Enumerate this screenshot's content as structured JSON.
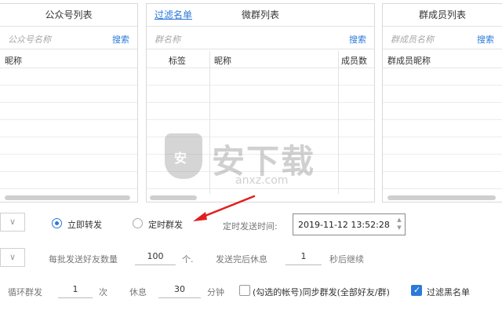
{
  "panels": {
    "official": {
      "title": "公众号列表",
      "search_placeholder": "公众号名称",
      "search_btn": "搜索",
      "col_nickname": "昵称"
    },
    "groups": {
      "filter_link": "过滤名单",
      "title": "微群列表",
      "search_placeholder": "群名称",
      "search_btn": "搜索",
      "col_tag": "标签",
      "col_nickname": "昵称",
      "col_members": "成员数"
    },
    "members": {
      "title": "群成员列表",
      "search_placeholder": "群成员名称",
      "search_btn": "搜索",
      "col_nickname": "群成员昵称"
    }
  },
  "watermark": {
    "badge": "安",
    "text": "安下载",
    "url": "anxz.com"
  },
  "controls": {
    "mode_immediate": "立即转发",
    "mode_scheduled": "定时群发",
    "mode_selected": "immediate",
    "schedule_label": "定时发送时间:",
    "schedule_value": "2019-11-12 13:52:28",
    "batch_label": "每批发送好友数量",
    "batch_value": "100",
    "batch_unit": "个.",
    "rest_label": "发送完后休息",
    "rest_value": "1",
    "rest_unit": "秒后继续",
    "loop_label": "循环群发",
    "loop_value": "1",
    "loop_unit": "次",
    "pause_label": "休息",
    "pause_value": "30",
    "pause_unit": "分钟",
    "sync_label": "(勾选的帐号)同步群发(全部好友/群)",
    "sync_checked": false,
    "blacklist_label": "过滤黑名单",
    "blacklist_checked": true
  },
  "colors": {
    "accent": "#2b79d9",
    "arrow": "#e02020"
  }
}
